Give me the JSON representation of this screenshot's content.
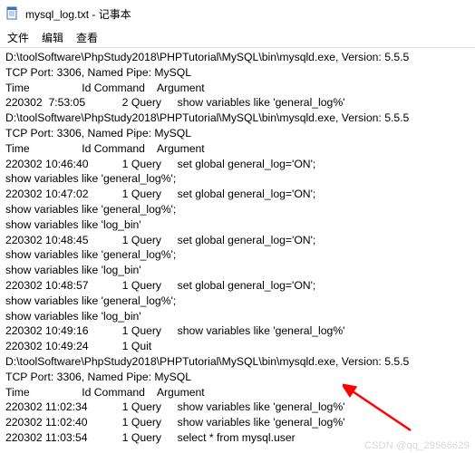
{
  "window": {
    "title": "mysql_log.txt - 记事本",
    "icon_name": "notepad-icon"
  },
  "menu": {
    "file": "文件",
    "edit": "编辑",
    "view": "查看"
  },
  "log_lines": [
    "D:\\toolSoftware\\PhpStudy2018\\PHPTutorial\\MySQL\\bin\\mysqld.exe, Version: 5.5.5",
    "TCP Port: 3306, Named Pipe: MySQL",
    "Time                 Id Command    Argument",
    "220302  7:53:05\t      2 Query\tshow variables like 'general_log%'",
    "D:\\toolSoftware\\PhpStudy2018\\PHPTutorial\\MySQL\\bin\\mysqld.exe, Version: 5.5.5",
    "TCP Port: 3306, Named Pipe: MySQL",
    "Time                 Id Command    Argument",
    "220302 10:46:40\t      1 Query\tset global general_log='ON';",
    "show variables like 'general_log%';",
    "220302 10:47:02\t      1 Query\tset global general_log='ON';",
    "show variables like 'general_log%';",
    "show variables like 'log_bin'",
    "220302 10:48:45\t      1 Query\tset global general_log='ON';",
    "show variables like 'general_log%';",
    "show variables like 'log_bin'",
    "220302 10:48:57\t      1 Query\tset global general_log='ON';",
    "show variables like 'general_log%';",
    "show variables like 'log_bin'",
    "220302 10:49:16\t      1 Query\tshow variables like 'general_log%'",
    "220302 10:49:24\t      1 Quit\t",
    "D:\\toolSoftware\\PhpStudy2018\\PHPTutorial\\MySQL\\bin\\mysqld.exe, Version: 5.5.5",
    "TCP Port: 3306, Named Pipe: MySQL",
    "Time                 Id Command    Argument",
    "220302 11:02:34\t      1 Query\tshow variables like 'general_log%'",
    "220302 11:02:40\t      1 Query\tshow variables like 'general_log%'",
    "220302 11:03:54\t      1 Query\tselect * from mysql.user"
  ],
  "annotation": {
    "arrow_color": "#ff0000"
  },
  "watermark": "CSDN @qq_29566629"
}
